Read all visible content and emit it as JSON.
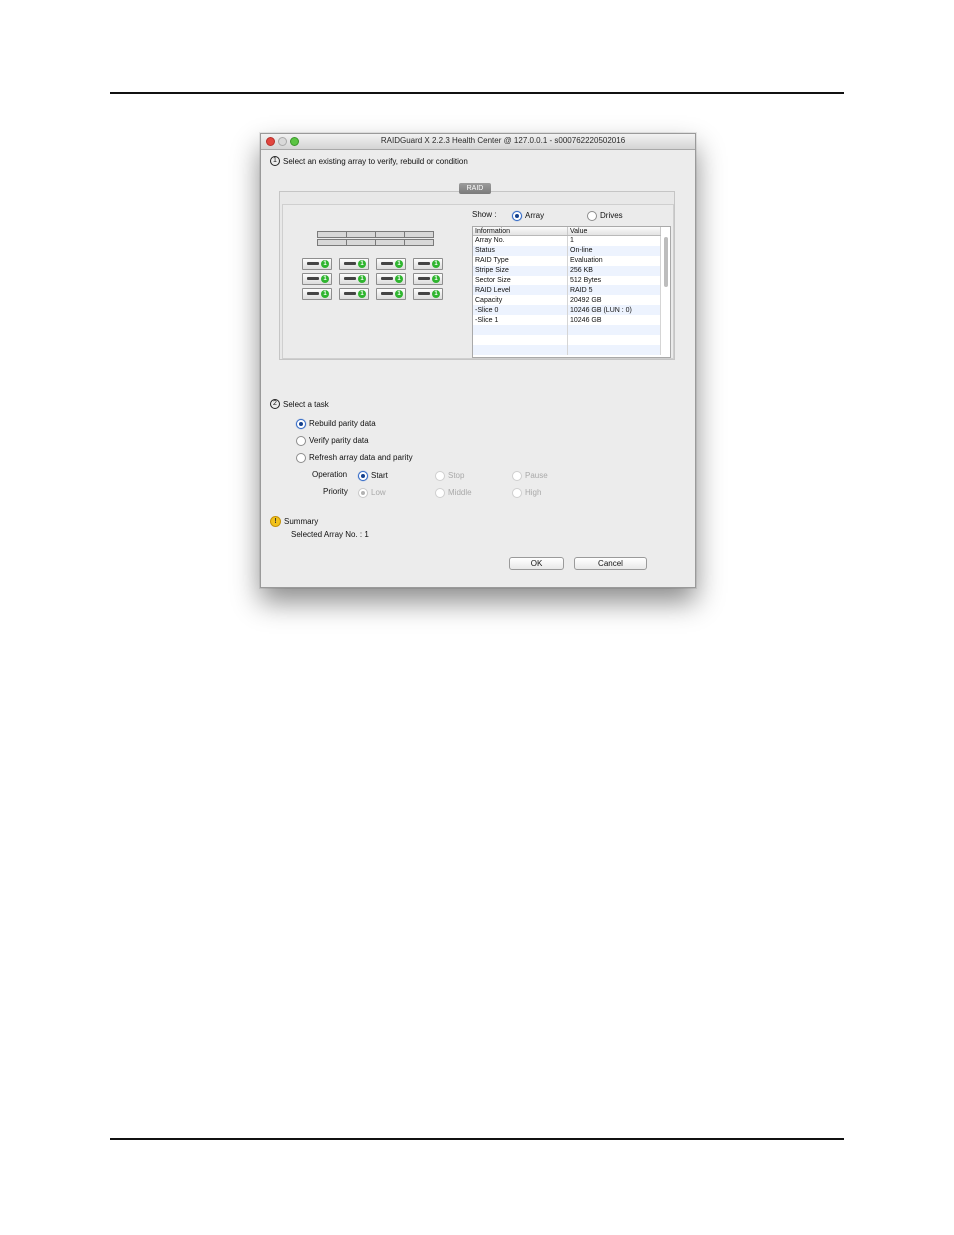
{
  "window": {
    "title": "RAIDGuard X 2.2.3 Health Center @ 127.0.0.1 - s000762220502016"
  },
  "step1": {
    "number": "1",
    "text": "Select an existing array to verify, rebuild or condition"
  },
  "raid_panel": {
    "tab_label": "RAID",
    "show_label": "Show :",
    "show_options": [
      {
        "label": "Array",
        "selected": true
      },
      {
        "label": "Drives",
        "selected": false
      }
    ],
    "drive_status_badge": "1",
    "drive_count": 12,
    "table": {
      "headers": [
        "Information",
        "Value"
      ],
      "rows": [
        [
          "Array No.",
          "1"
        ],
        [
          "Status",
          "On-line"
        ],
        [
          "RAID Type",
          "Evaluation"
        ],
        [
          "Stripe Size",
          "256 KB"
        ],
        [
          "Sector Size",
          "512 Bytes"
        ],
        [
          "RAID Level",
          "RAID 5"
        ],
        [
          "Capacity",
          "20492 GB"
        ],
        [
          "-Slice 0",
          " 10246 GB (LUN : 0)"
        ],
        [
          "-Slice 1",
          " 10246 GB"
        ]
      ]
    }
  },
  "step2": {
    "number": "2",
    "text": "Select a task",
    "tasks": [
      {
        "label": "Rebuild parity data",
        "selected": true
      },
      {
        "label": "Verify parity data",
        "selected": false
      },
      {
        "label": "Refresh array data and parity",
        "selected": false
      }
    ],
    "operation": {
      "label": "Operation",
      "options": [
        {
          "label": "Start",
          "selected": true,
          "enabled": true
        },
        {
          "label": "Stop",
          "selected": false,
          "enabled": false
        },
        {
          "label": "Pause",
          "selected": false,
          "enabled": false
        }
      ]
    },
    "priority": {
      "label": "Priority",
      "options": [
        {
          "label": "Low",
          "selected": true,
          "enabled": false
        },
        {
          "label": "Middle",
          "selected": false,
          "enabled": false
        },
        {
          "label": "High",
          "selected": false,
          "enabled": false
        }
      ]
    }
  },
  "summary": {
    "icon": "!",
    "title": "Summary",
    "text": "Selected Array No. : 1"
  },
  "buttons": {
    "ok": "OK",
    "cancel": "Cancel"
  },
  "colors": {
    "window_bg": "#ececec",
    "close": "#e2463f",
    "zoom": "#5bc443",
    "drive_led": "#2fb52f",
    "warning": "#f2c21b"
  }
}
